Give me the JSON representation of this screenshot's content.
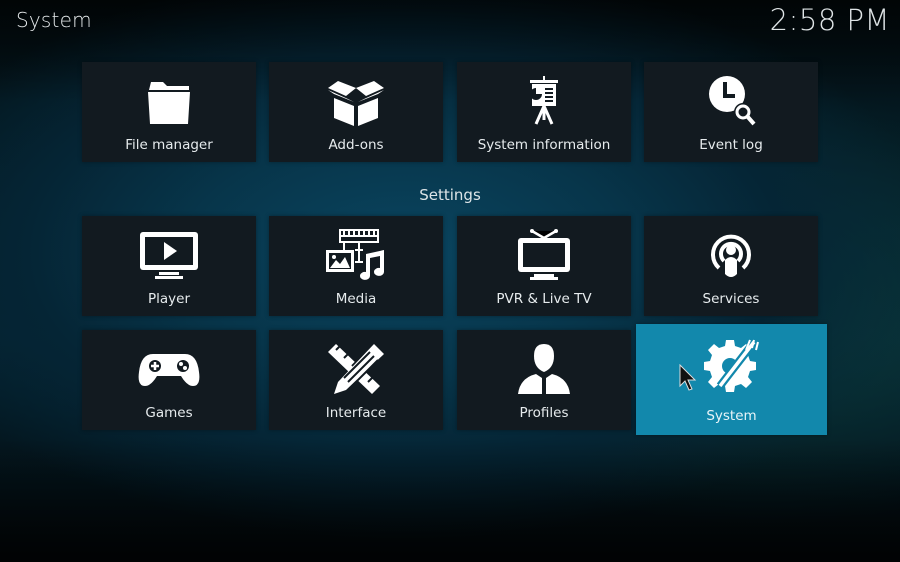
{
  "header": {
    "title": "System",
    "clock": "2:58 PM"
  },
  "top_row": [
    {
      "label": "File manager",
      "icon": "folder-icon"
    },
    {
      "label": "Add-ons",
      "icon": "open-box-icon"
    },
    {
      "label": "System information",
      "icon": "presentation-board-icon"
    },
    {
      "label": "Event log",
      "icon": "clock-search-icon"
    }
  ],
  "settings": {
    "section_label": "Settings",
    "items": [
      {
        "label": "Player",
        "icon": "monitor-play-icon"
      },
      {
        "label": "Media",
        "icon": "media-filmstrip-music-icon"
      },
      {
        "label": "PVR & Live TV",
        "icon": "tv-antenna-icon"
      },
      {
        "label": "Services",
        "icon": "broadcast-user-icon"
      },
      {
        "label": "Games",
        "icon": "gamepad-icon"
      },
      {
        "label": "Interface",
        "icon": "ruler-pencil-icon"
      },
      {
        "label": "Profiles",
        "icon": "user-profile-icon"
      },
      {
        "label": "System",
        "icon": "gear-wrench-icon",
        "selected": true
      }
    ]
  },
  "colors": {
    "tile_bg": "#121a20",
    "selected_bg": "#1288ac",
    "text": "#e6ebed"
  }
}
